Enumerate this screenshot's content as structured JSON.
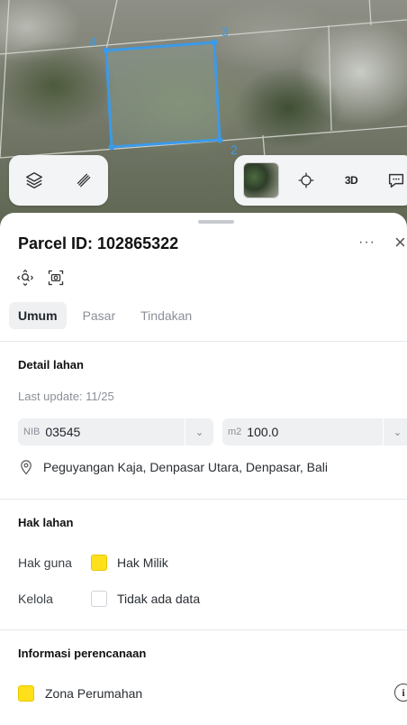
{
  "map": {
    "vertices": [
      "4",
      "3",
      "2"
    ],
    "layers_icon": "layers-icon",
    "measure_icon": "measure-icon",
    "locate_icon": "crosshair-icon",
    "mode_3d_label": "3D",
    "feedback_icon": "feedback-icon"
  },
  "sheet": {
    "title": "Parcel ID: 102865322",
    "more_label": "···",
    "close_label": "×",
    "tabs": [
      {
        "label": "Umum",
        "active": true
      },
      {
        "label": "Pasar",
        "active": false
      },
      {
        "label": "Tindakan",
        "active": false
      }
    ],
    "land_detail": {
      "title": "Detail lahan",
      "last_update": "Last update: 11/25",
      "nib_prefix": "NIB",
      "nib_value": "03545",
      "area_prefix": "m2",
      "area_value": "100.0",
      "address": "Peguyangan Kaja, Denpasar Utara, Denpasar, Bali"
    },
    "land_rights": {
      "title": "Hak lahan",
      "rows": [
        {
          "label": "Hak guna",
          "value": "Hak Milik",
          "color": "#ffe01b"
        },
        {
          "label": "Kelola",
          "value": "Tidak ada data",
          "color": "#ffffff"
        }
      ]
    },
    "planning": {
      "title": "Informasi perencanaan",
      "zone": "Zona Perumahan",
      "zone_color": "#ffe01b"
    }
  },
  "colors": {
    "parcel_outline": "#3b9ae8",
    "accent_yellow": "#ffe01b"
  }
}
